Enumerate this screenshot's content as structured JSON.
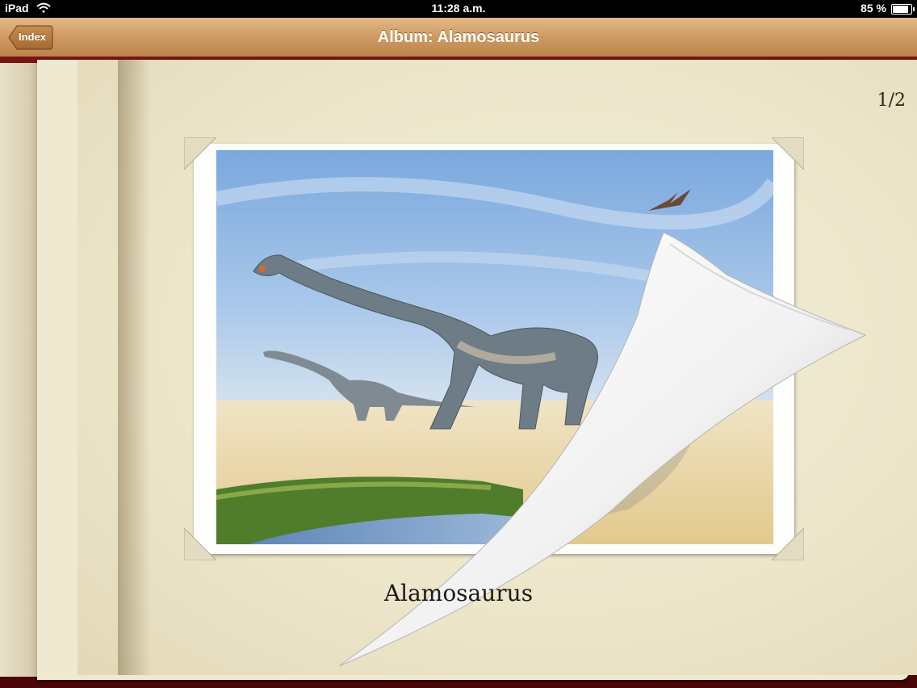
{
  "status_bar": {
    "carrier": "iPad",
    "time": "11:28 a.m.",
    "battery": "85 %",
    "battery_level": 0.85
  },
  "nav": {
    "back_label": "Index",
    "title": "Album: Alamosaurus"
  },
  "album": {
    "page_indicator": "1/2",
    "caption": "Alamosaurus",
    "current_page": 1,
    "total_pages": 2
  },
  "colors": {
    "navbar": "#cf9a62",
    "cover": "#6a0e0e",
    "paper": "#ece5c9",
    "sky": "#8cb6e4"
  },
  "icons": [
    "wifi-icon",
    "battery-icon",
    "back-chevron-icon"
  ]
}
